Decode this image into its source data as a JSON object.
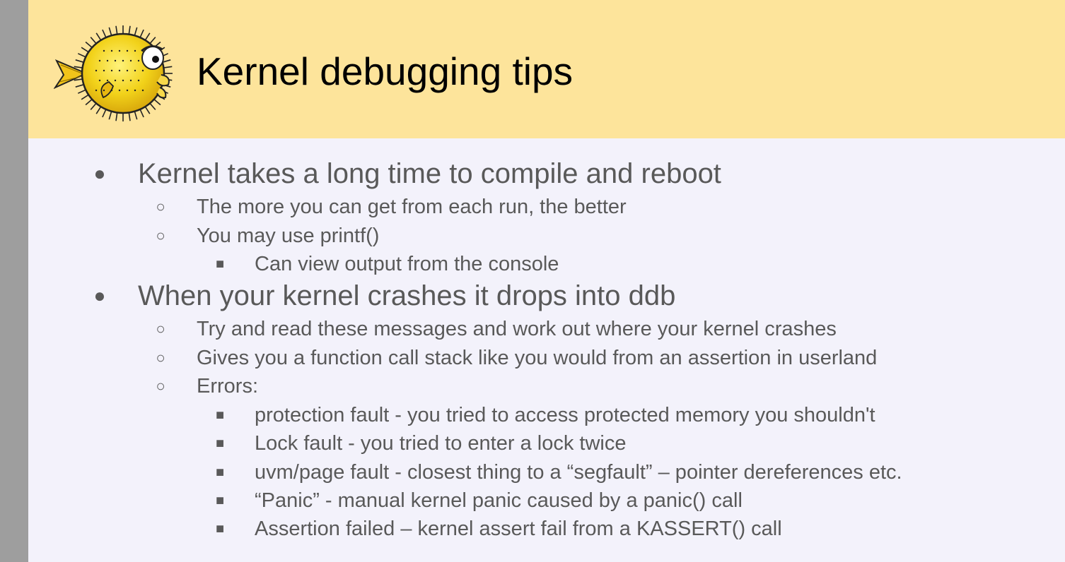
{
  "slide": {
    "title": "Kernel debugging tips",
    "logo_icon": "pufferfish-logo",
    "colors": {
      "header_background": "#fde49b",
      "body_background": "#f3f2fb",
      "left_bar": "#9e9e9e",
      "body_text": "#595959",
      "title_text": "#000000"
    }
  },
  "markers": {
    "level1": "●",
    "level2": "○",
    "level3": "■"
  },
  "bullets": [
    {
      "text": "Kernel takes a long time to compile and reboot",
      "children": [
        {
          "text": "The more you can get from each run, the better"
        },
        {
          "text": "You may use printf()",
          "children": [
            {
              "text": "Can view output from the console"
            }
          ]
        }
      ]
    },
    {
      "text": "When your kernel crashes it drops into ddb",
      "children": [
        {
          "text": "Try and read these messages and work out where your kernel crashes"
        },
        {
          "text": "Gives you a function call stack like you would from an assertion in userland"
        },
        {
          "text": "Errors:",
          "children": [
            {
              "text": "protection fault - you tried to access protected memory you shouldn't"
            },
            {
              "text": "Lock fault - you tried to enter a lock twice"
            },
            {
              "text": "uvm/page fault - closest thing to a “segfault” – pointer dereferences etc."
            },
            {
              "text": "“Panic” - manual kernel panic caused by a panic() call"
            },
            {
              "text": "Assertion failed – kernel assert fail from a KASSERT() call"
            }
          ]
        }
      ]
    }
  ]
}
